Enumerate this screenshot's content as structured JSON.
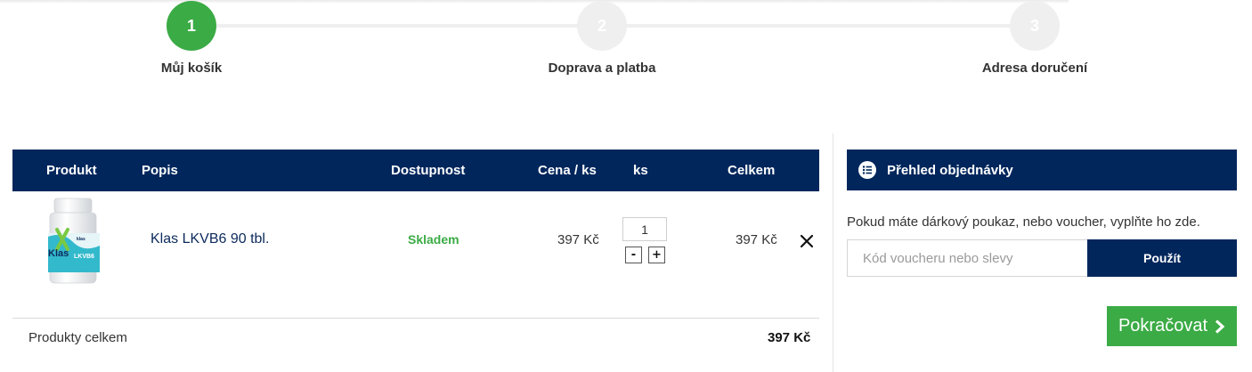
{
  "steps": [
    {
      "number": "1",
      "label": "Můj košík",
      "state": "active"
    },
    {
      "number": "2",
      "label": "Doprava a platba",
      "state": "inactive"
    },
    {
      "number": "3",
      "label": "Adresa doručení",
      "state": "inactive"
    }
  ],
  "cart": {
    "headers": {
      "product": "Produkt",
      "description": "Popis",
      "availability": "Dostupnost",
      "unit_price": "Cena / ks",
      "quantity": "ks",
      "total": "Celkem"
    },
    "items": [
      {
        "name": "Klas LKVB6 90 tbl.",
        "availability": "Skladem",
        "unit_price": "397 Kč",
        "quantity": "1",
        "total": "397 Kč",
        "image_brand": "klas",
        "image_text": "Klas",
        "image_product": "LKVB6"
      }
    ],
    "qty_minus": "-",
    "qty_plus": "+",
    "summary_label": "Produkty celkem",
    "summary_value": "397 Kč"
  },
  "order_summary": {
    "title": "Přehled objednávky",
    "voucher_prompt": "Pokud máte dárkový poukaz, nebo voucher, vyplňte ho zde.",
    "voucher_placeholder": "Kód voucheru nebo slevy",
    "apply_label": "Použít",
    "continue_label": "Pokračovat"
  },
  "colors": {
    "navy": "#00265c",
    "green": "#3bab45",
    "step_inactive": "#efefef"
  },
  "icons": {
    "summary": "list-icon",
    "remove": "close-icon",
    "continue": "chevron-right-icon"
  }
}
